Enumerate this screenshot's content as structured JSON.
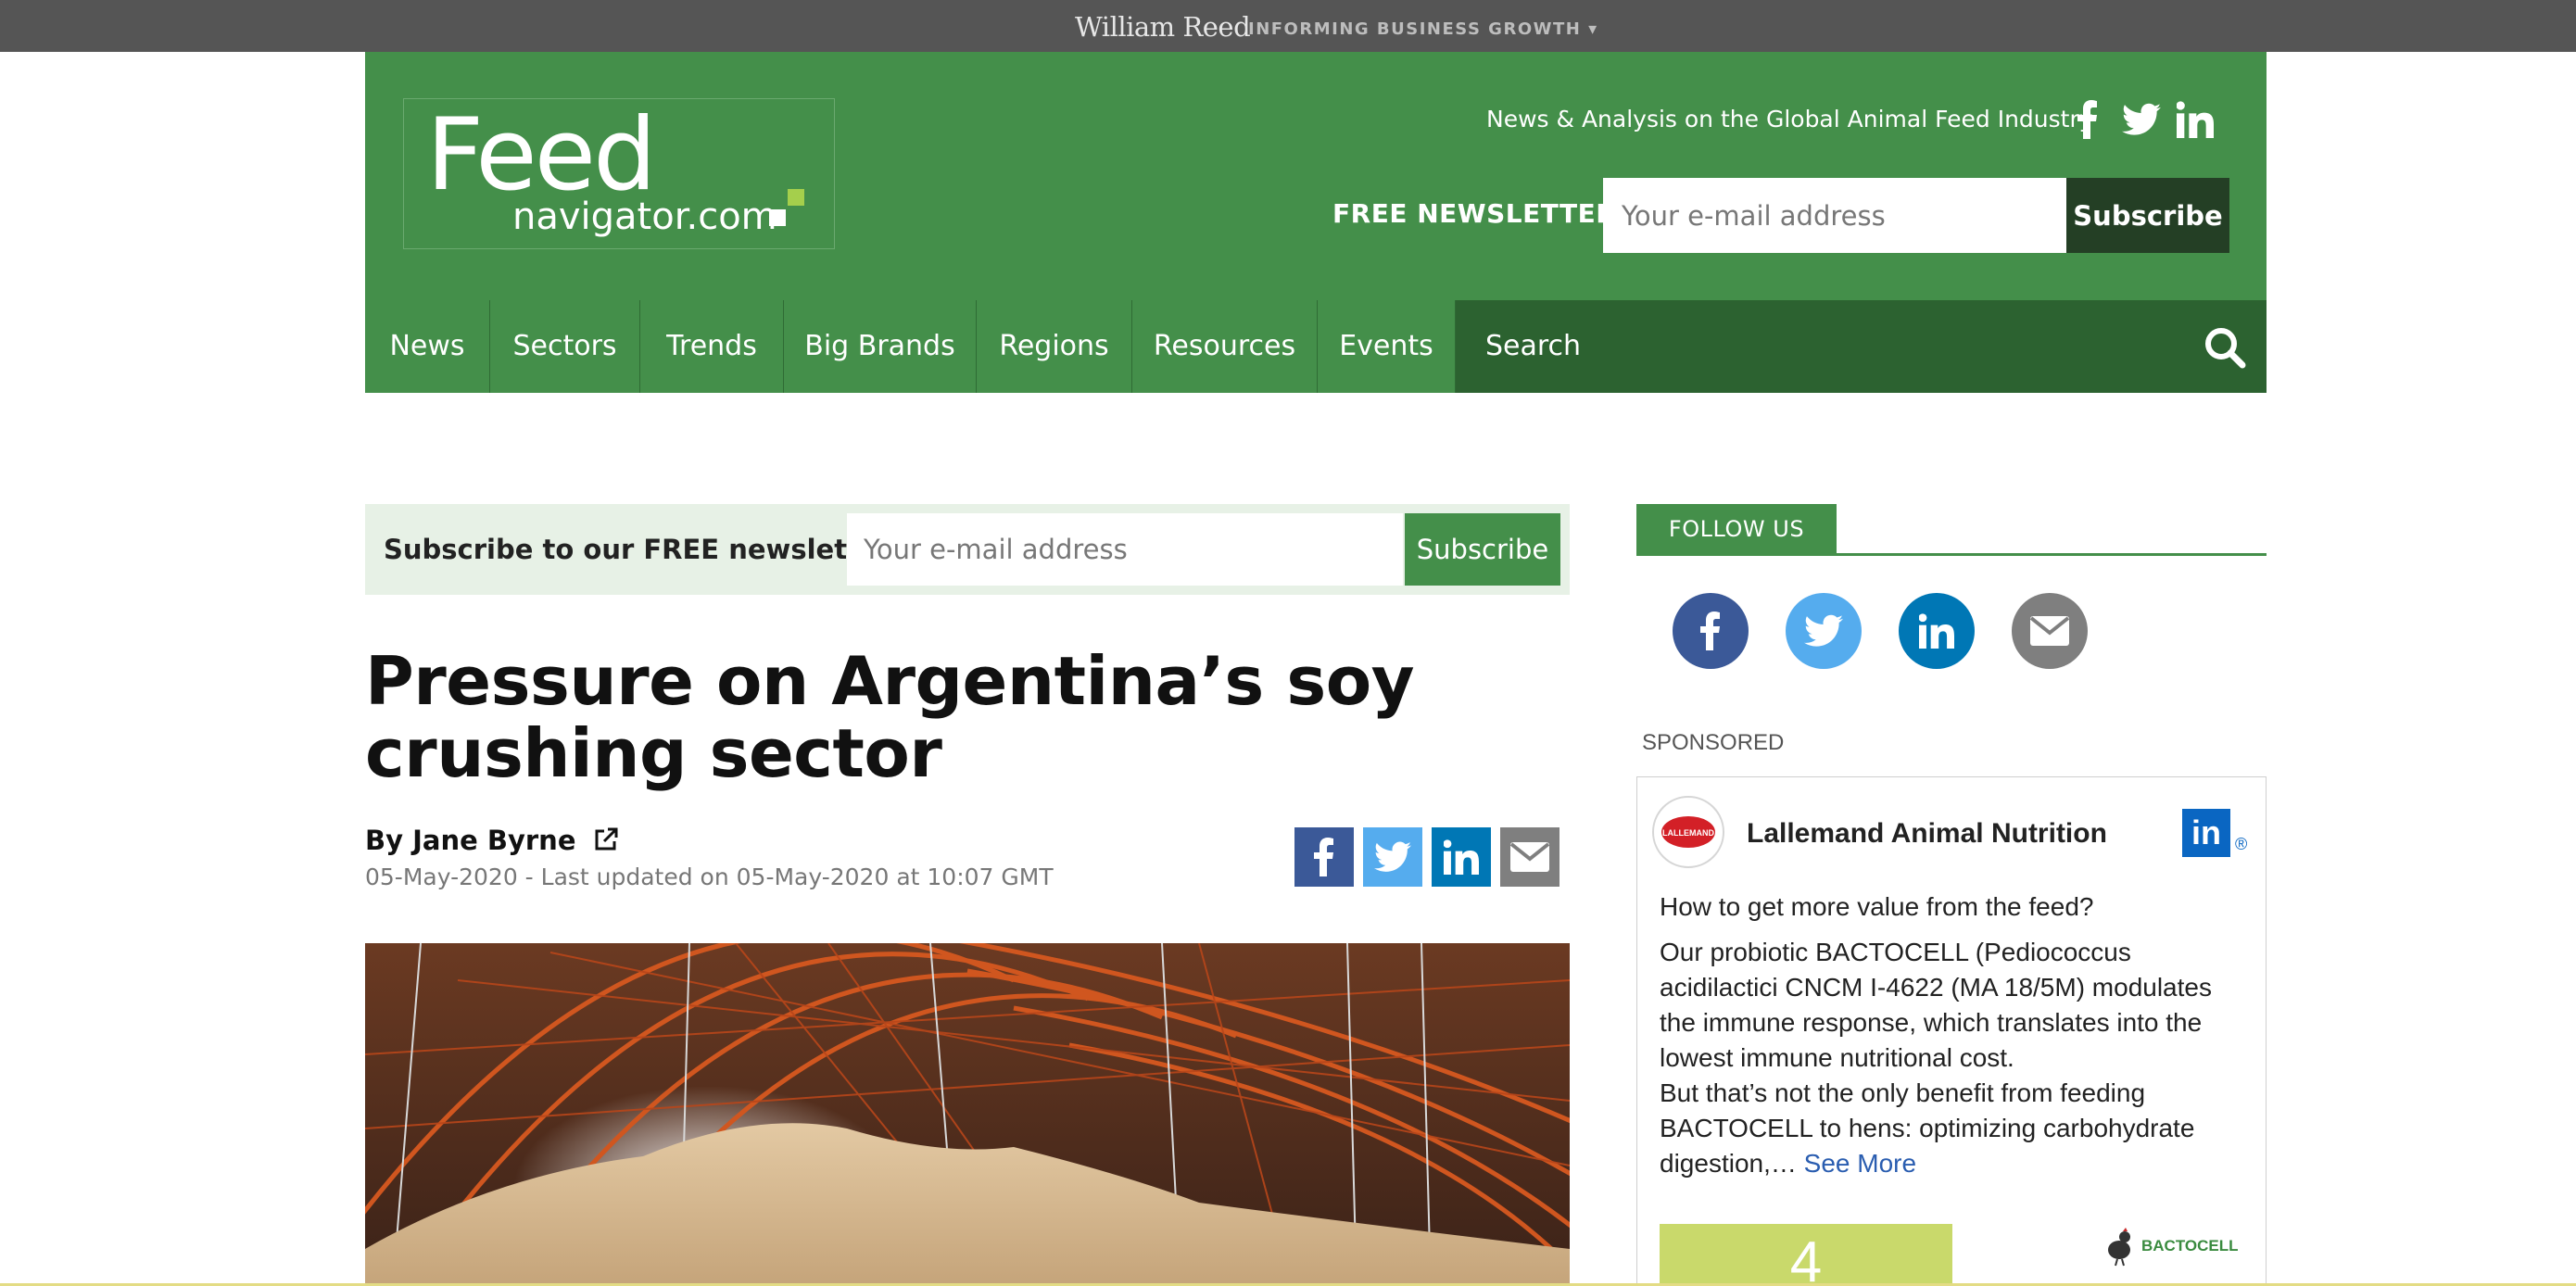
{
  "topbar": {
    "brand": "William Reed",
    "tagline": "INFORMING BUSINESS GROWTH ▾"
  },
  "header": {
    "logo_main": "Feed",
    "logo_domain": "navigator.com",
    "tagline": "News & Analysis on the Global Animal Feed Industry",
    "newsletter_label": "FREE NEWSLETTER",
    "email_placeholder": "Your e-mail address",
    "subscribe_label": "Subscribe",
    "social_icons": [
      "facebook-icon",
      "twitter-icon",
      "linkedin-icon"
    ]
  },
  "nav": {
    "items": [
      "News",
      "Sectors",
      "Trends",
      "Big Brands",
      "Regions",
      "Resources",
      "Events"
    ],
    "search_label": "Search"
  },
  "subscribe_bar": {
    "label": "Subscribe to our FREE newsletter",
    "email_placeholder": "Your e-mail address",
    "button": "Subscribe"
  },
  "article": {
    "headline": "Pressure on Argentina’s soy crushing sector",
    "author": "By Jane Byrne",
    "dateline": "05-May-2020 - Last updated on 05-May-2020 at 10:07 GMT",
    "share_icons": [
      "facebook-icon",
      "twitter-icon",
      "linkedin-icon",
      "email-icon"
    ]
  },
  "sidebar": {
    "follow_label": "FOLLOW US",
    "follow_icons": [
      "facebook-icon",
      "twitter-icon",
      "linkedin-icon",
      "email-icon"
    ],
    "sponsored_label": "SPONSORED",
    "sponsor": {
      "name": "Lallemand Animal Nutrition",
      "avatar_text": "LALLEMAND",
      "linkedin_badge": "in",
      "registered_mark": "®",
      "question": "How to get more value from the feed?",
      "body": "Our probiotic BACTOCELL (Pediococcus acidilactici CNCM I-4622 (MA 18/5M) modulates the immune response, which translates into the lowest immune nutritional cost.\nBut that’s not the only benefit from feeding BACTOCELL to hens: optimizing carbohydrate digestion,… ",
      "see_more": "See More",
      "highlight_number": "4",
      "product_logo_text": "BACTOCELL"
    }
  },
  "colors": {
    "brand_green": "#448f4a",
    "dark_green": "#2c6230",
    "darkest_green": "#243f25",
    "facebook": "#3b5998",
    "twitter": "#55acee",
    "linkedin": "#0077b5",
    "email": "#7f7f7f"
  }
}
